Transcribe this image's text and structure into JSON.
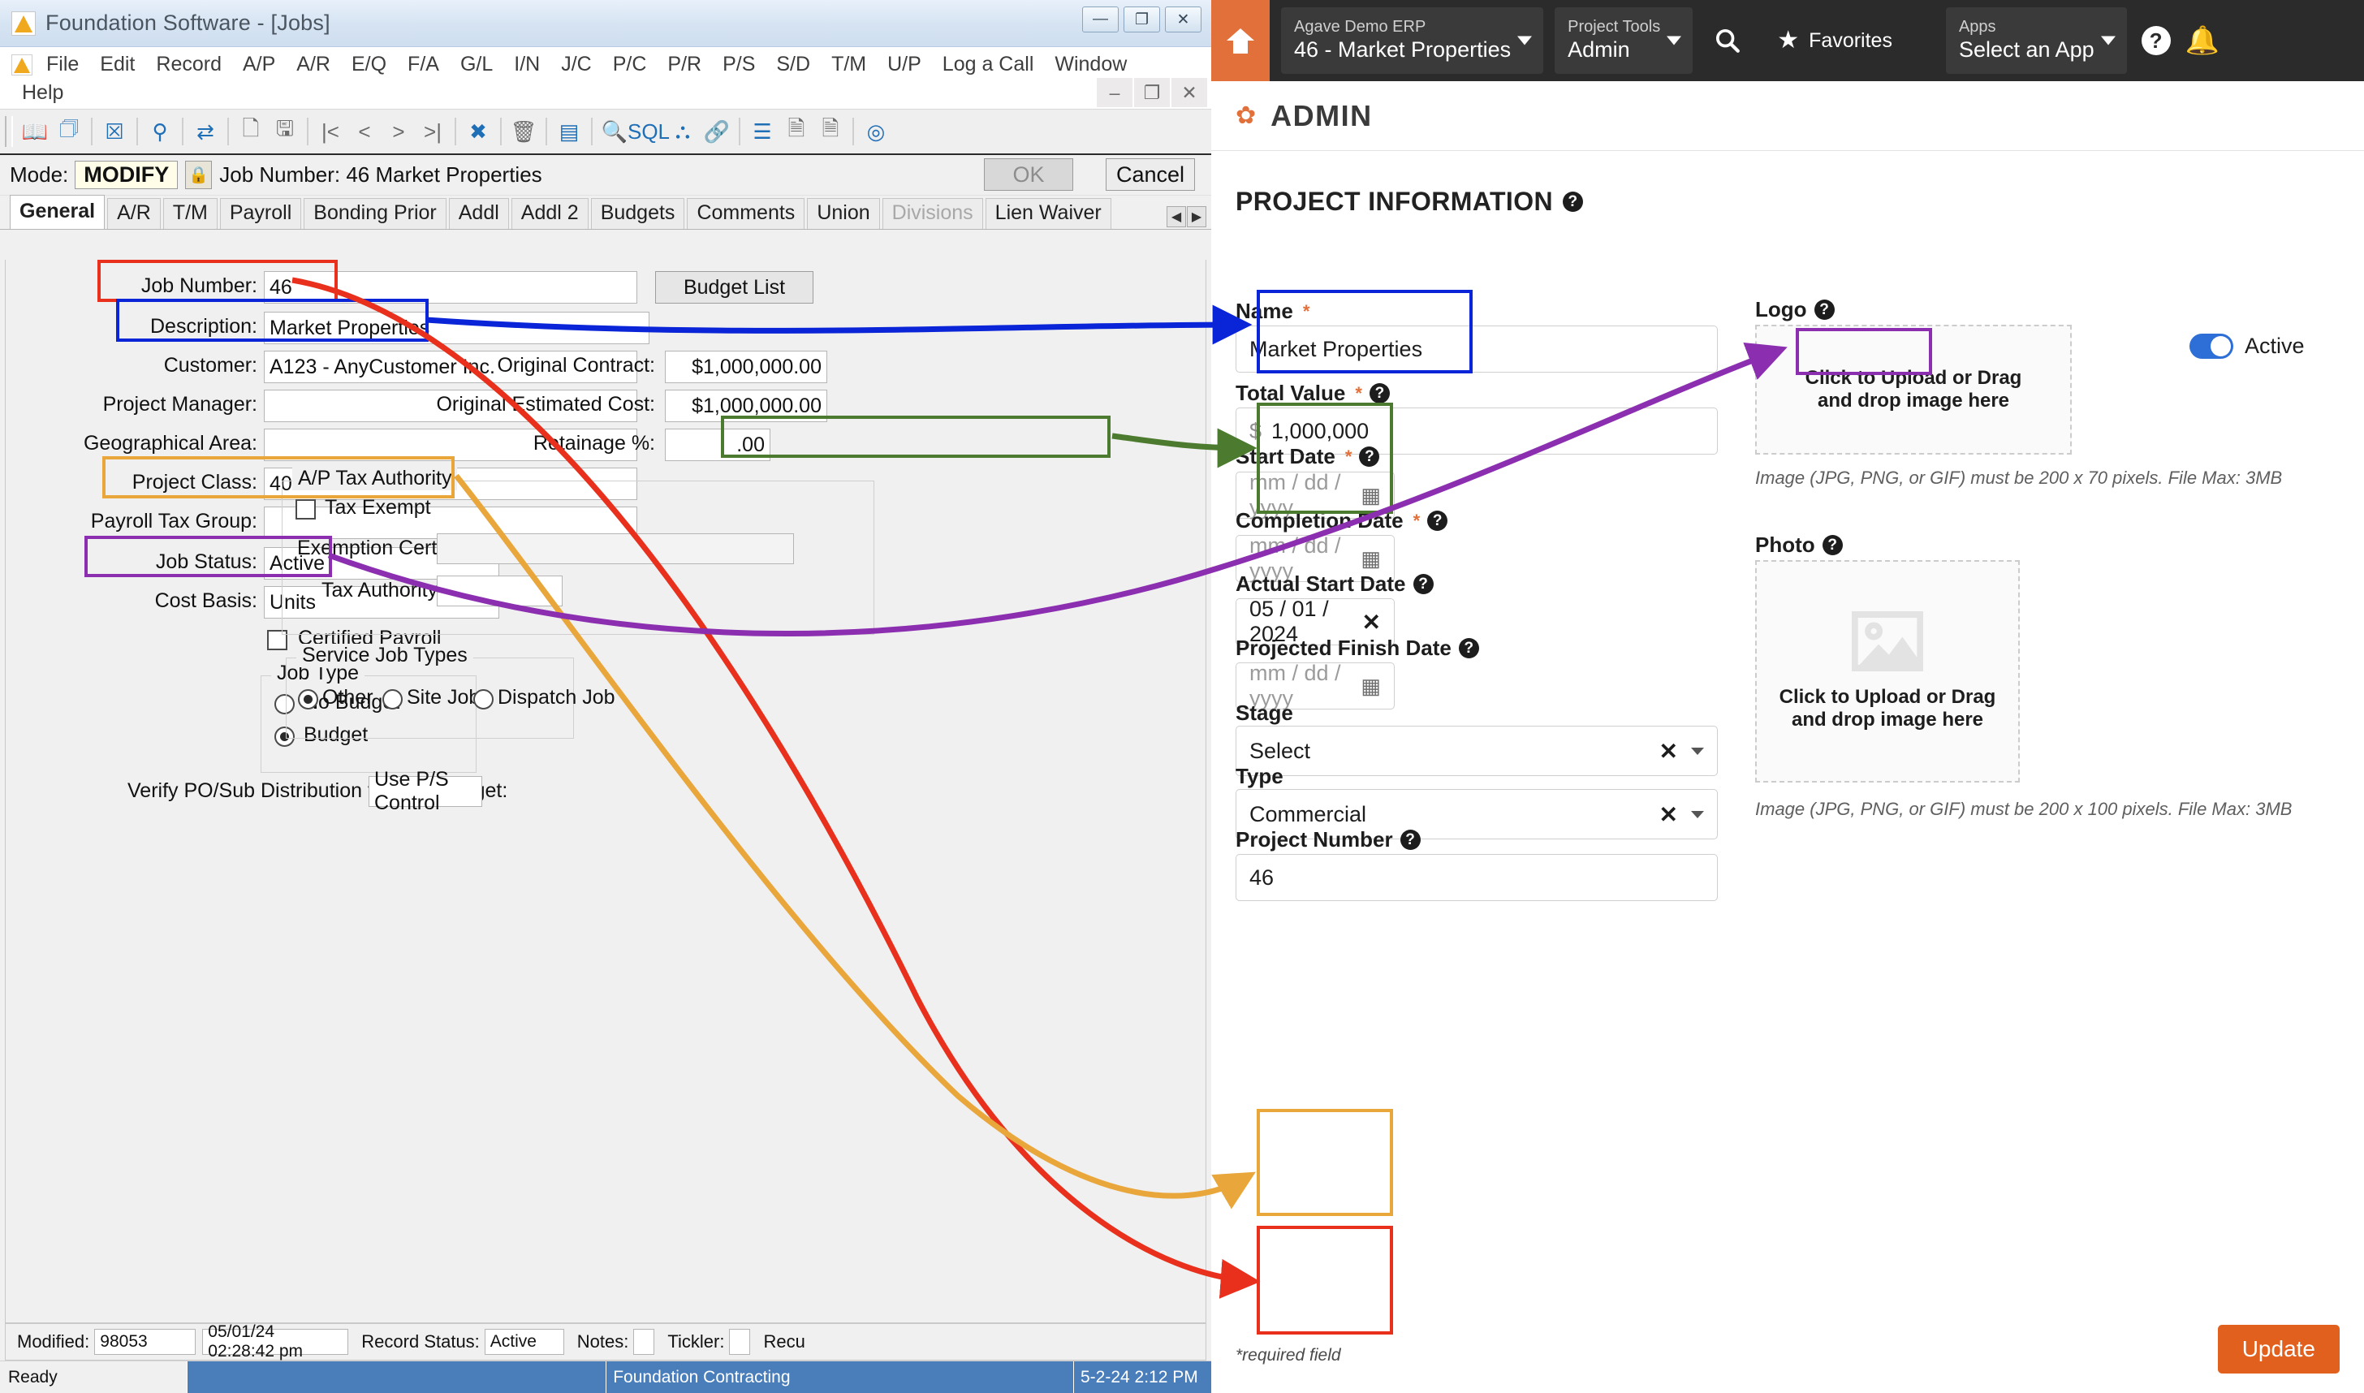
{
  "legacy": {
    "window_title": "Foundation Software - [Jobs]",
    "window_buttons": {
      "minimize": "—",
      "maximize": "❐",
      "close": "✕"
    },
    "mdi_buttons": {
      "minimize": "–",
      "restore": "❐",
      "close": "✕"
    },
    "menu": [
      "File",
      "Edit",
      "Record",
      "A/P",
      "A/R",
      "E/Q",
      "F/A",
      "G/L",
      "I/N",
      "J/C",
      "P/C",
      "P/R",
      "P/S",
      "S/D",
      "T/M",
      "U/P",
      "Log a Call",
      "Window",
      "Help"
    ],
    "toolbar_icons": [
      "book-icon",
      "copy-icon",
      "cancel-box-icon",
      "location-pin-icon",
      "transfer-icon",
      "new-document-icon",
      "save-icon",
      "first-record-icon",
      "previous-record-icon",
      "next-record-icon",
      "last-record-icon",
      "delete-x-icon",
      "trash-icon",
      "list-icon",
      "find-icon",
      "sql-icon",
      "flowchart-icon",
      "link-icon",
      "grid-icon",
      "note-icon",
      "report-icon",
      "lifering-icon"
    ],
    "mode_label": "Mode:",
    "mode_value": "MODIFY",
    "record_header": "Job Number: 46  Market Properties",
    "ok_label": "OK",
    "cancel_label": "Cancel",
    "tabs": [
      "General",
      "A/R",
      "T/M",
      "Payroll",
      "Bonding Prior",
      "Addl",
      "Addl 2",
      "Budgets",
      "Comments",
      "Union",
      "Divisions",
      "Lien Waiver"
    ],
    "active_tab": "General",
    "disabled_tab": "Divisions",
    "fields": {
      "job_number": {
        "label": "Job Number:",
        "value": "46"
      },
      "budget_list": {
        "label": "Budget List"
      },
      "description": {
        "label": "Description:",
        "value": "Market Properties"
      },
      "customer": {
        "label": "Customer:",
        "value": "A123  - AnyCustomer Inc."
      },
      "project_manager": {
        "label": "Project Manager:",
        "value": ""
      },
      "geographical_area": {
        "label": "Geographical  Area:",
        "value": ""
      },
      "project_class": {
        "label": "Project Class:",
        "value": "4000  - Commercial"
      },
      "payroll_tax_group": {
        "label": "Payroll Tax Group:",
        "value": ""
      },
      "job_status": {
        "label": "Job Status:",
        "value": "Active"
      },
      "cost_basis": {
        "label": "Cost Basis:",
        "value": "Units"
      },
      "certified_payroll": {
        "label": "Certified Payroll",
        "checked": false
      },
      "original_contract": {
        "label": "Original Contract:",
        "value": "$1,000,000.00"
      },
      "original_estimated_cost": {
        "label": "Original Estimated Cost:",
        "value": "$1,000,000.00"
      },
      "retainage_pct": {
        "label": "Retainage %:",
        "value": ".00"
      },
      "ap_tax_authority_group": {
        "label": "A/P Tax Authority"
      },
      "tax_exempt": {
        "label": "Tax Exempt",
        "checked": false
      },
      "exemption_certificate": {
        "label": "Exemption Certificate #:",
        "value": ""
      },
      "tax_authority": {
        "label": "Tax Authority:",
        "value": ""
      },
      "job_type_group": {
        "label": "Job Type"
      },
      "job_type_options": [
        "No Budget",
        "Budget"
      ],
      "job_type_selected": "Budget",
      "service_job_types_group": {
        "label": "Service Job Types"
      },
      "service_job_options": [
        "Other",
        "Site Job",
        "Dispatch Job"
      ],
      "service_job_selected": "Other",
      "verify_po": {
        "label": "Verify PO/Sub Distribution vs. Job Budget:",
        "value": "Use P/S Control"
      }
    },
    "footer": {
      "modified_label": "Modified:",
      "modified_user": "98053",
      "modified_date": "05/01/24 02:28:42 pm",
      "record_status_label": "Record Status:",
      "record_status_value": "Active",
      "notes_label": "Notes:",
      "tickler_label": "Tickler:",
      "recurring_label": "Recu"
    },
    "statusbar": {
      "ready": "Ready",
      "company": "Foundation Contracting",
      "datetime": "5-2-24 2:12 PM"
    }
  },
  "web": {
    "topbar": {
      "home_icon": "home-icon",
      "erp_selector": {
        "small": "Agave Demo ERP",
        "big": "46 - Market Properties"
      },
      "tool_selector": {
        "small": "Project Tools",
        "big": "Admin"
      },
      "search_icon": "search-icon",
      "favorites_label": "Favorites",
      "favorites_icon": "star-icon",
      "apps_selector": {
        "small": "Apps",
        "big": "Select an App"
      },
      "help_icon": "question-mark-icon",
      "bell_icon": "bell-icon"
    },
    "page_title": "ADMIN",
    "section_title": "PROJECT INFORMATION",
    "form": {
      "name": {
        "label": "Name",
        "required": true,
        "value": "Market Properties"
      },
      "active_toggle": {
        "label": "Active",
        "on": true
      },
      "total_value": {
        "label": "Total Value",
        "required": true,
        "prefix": "$",
        "value": "1,000,000"
      },
      "start_date": {
        "label": "Start Date",
        "required": true,
        "placeholder": "mm / dd / yyyy",
        "value": ""
      },
      "completion_date": {
        "label": "Completion Date",
        "required": true,
        "placeholder": "mm / dd / yyyy",
        "value": ""
      },
      "actual_start_date": {
        "label": "Actual Start Date",
        "required": false,
        "value": "05 / 01 / 2024"
      },
      "projected_finish_date": {
        "label": "Projected Finish Date",
        "required": false,
        "placeholder": "mm / dd / yyyy",
        "value": ""
      },
      "stage": {
        "label": "Stage",
        "value": "Select"
      },
      "type": {
        "label": "Type",
        "value": "Commercial"
      },
      "project_number": {
        "label": "Project Number",
        "value": "46"
      },
      "logo": {
        "label": "Logo",
        "dropzone_text": "Click to Upload or Drag and drop image here",
        "hint": "Image (JPG, PNG, or GIF) must be 200 x 70 pixels. File Max: 3MB"
      },
      "photo": {
        "label": "Photo",
        "dropzone_text": "Click to Upload or Drag and drop image here",
        "hint": "Image (JPG, PNG, or GIF) must be 200 x 100 pixels. File Max: 3MB"
      }
    },
    "required_note": "*required field",
    "update_label": "Update"
  },
  "annotations": {
    "colors": {
      "red": "#e8301c",
      "blue": "#0a24d8",
      "orange": "#e9a63b",
      "purple": "#8b2fb0",
      "green": "#4c7a2e"
    },
    "pairs": [
      {
        "color": "red",
        "from": "Job Number: 46",
        "to": "Project Number: 46"
      },
      {
        "color": "blue",
        "from": "Description: Market Properties",
        "to": "Name: Market Properties"
      },
      {
        "color": "green",
        "from": "Original Contract: $1,000,000.00",
        "to": "Total Value: $ 1,000,000"
      },
      {
        "color": "orange",
        "from": "Project Class: 4000 - Commercial",
        "to": "Type: Commercial"
      },
      {
        "color": "purple",
        "from": "Job Status: Active",
        "to": "Active toggle"
      }
    ]
  }
}
